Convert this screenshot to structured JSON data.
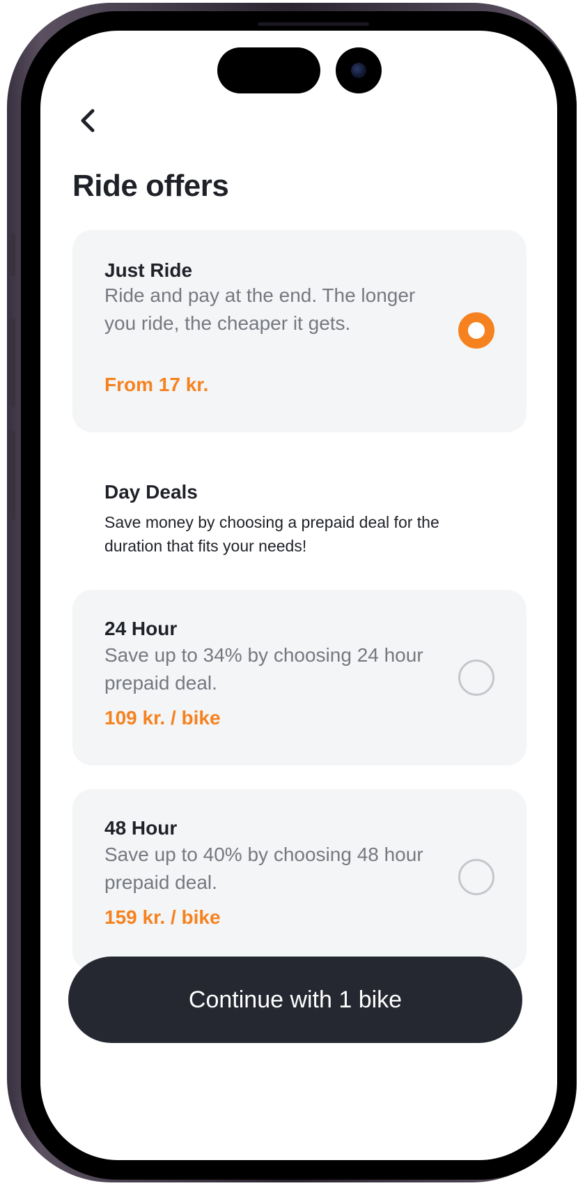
{
  "header": {
    "back_icon": "chevron-left-icon",
    "title": "Ride offers"
  },
  "offers": [
    {
      "title": "Just Ride",
      "description": "Ride and pay at the end. The longer you ride, the cheaper it gets.",
      "price": "From 17 kr.",
      "selected": true
    }
  ],
  "day_deals": {
    "title": "Day Deals",
    "description": "Save money by choosing a prepaid deal for the duration that fits your needs!",
    "items": [
      {
        "title": "24 Hour",
        "description": "Save up to 34% by choosing 24 hour prepaid deal.",
        "price": "109 kr. / bike",
        "selected": false
      },
      {
        "title": "48 Hour",
        "description": "Save up to 40% by choosing 48 hour prepaid deal.",
        "price": "159 kr. / bike",
        "selected": false
      }
    ]
  },
  "footer": {
    "continue_label": "Continue with 1 bike"
  },
  "colors": {
    "accent": "#f5821f",
    "card_bg": "#f4f5f7",
    "button_bg": "#252731",
    "text_primary": "#1f2128",
    "text_secondary": "#75787f"
  }
}
